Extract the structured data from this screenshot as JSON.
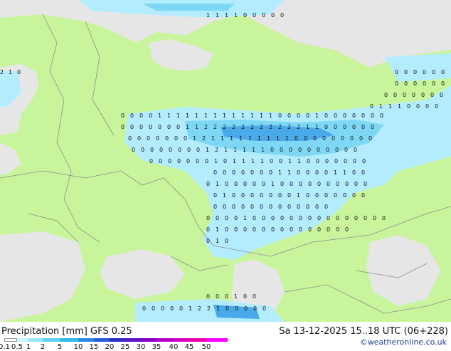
{
  "footer": {
    "title_left": "Precipitation [mm]  GFS 0.25",
    "title_right": "Sa 13-12-2025 15..18 UTC (06+228)",
    "credit": "©weatheronline.co.uk"
  },
  "legend": {
    "ticks": [
      "0.1",
      "0.5",
      "1",
      "2",
      "5",
      "10",
      "15",
      "20",
      "25",
      "30",
      "35",
      "40",
      "45",
      "50"
    ],
    "colors": [
      "#ffffff",
      "#c8f5ff",
      "#9ae6ff",
      "#5fd2f5",
      "#30bce8",
      "#2d8ce0",
      "#2a5bd8",
      "#2e2fc8",
      "#5a14c8",
      "#8a00c8",
      "#b800c8",
      "#d800c0",
      "#ee00aa",
      "#ff00ff"
    ]
  },
  "map": {
    "colors": {
      "land": "#c8f59b",
      "water": "#e6e6e6",
      "precip_light": "#b4ecff",
      "precip_mid": "#7ed8f5",
      "precip_heavy": "#4aa9e8",
      "border": "#8c8c8c"
    },
    "grid_values": [
      "0",
      "1",
      "2"
    ]
  }
}
